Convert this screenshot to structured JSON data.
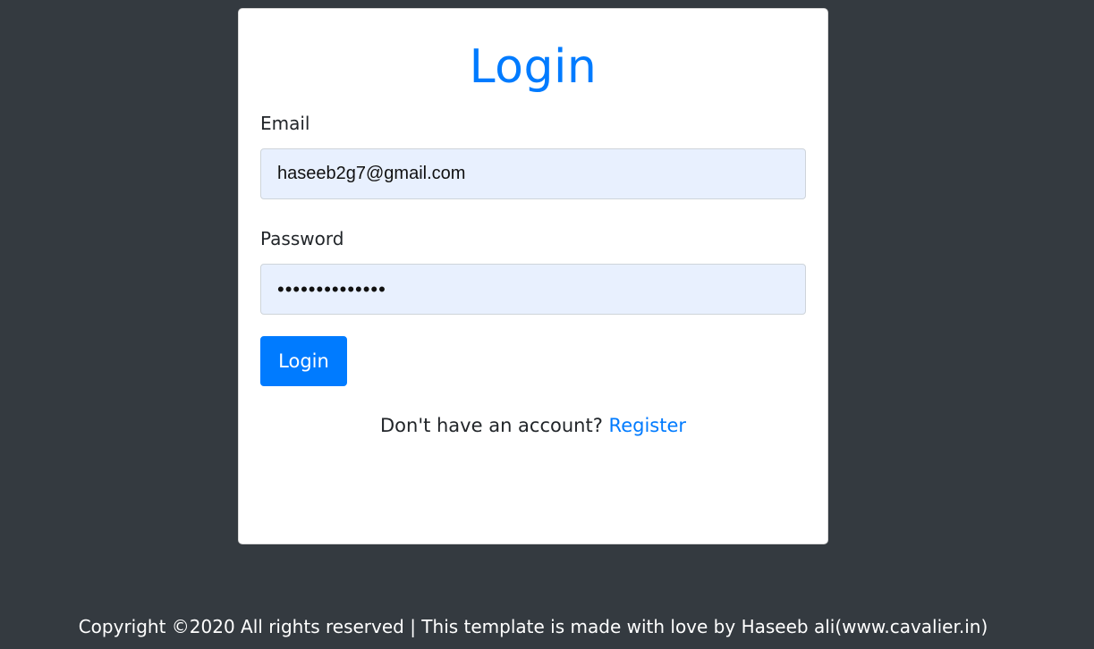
{
  "login_card": {
    "title": "Login",
    "email": {
      "label": "Email",
      "value": "haseeb2g7@gmail.com"
    },
    "password": {
      "label": "Password",
      "value": "••••••••••••••"
    },
    "submit_label": "Login",
    "register_prompt": "Don't have an account?",
    "register_link": "Register"
  },
  "footer": {
    "text": "Copyright ©2020 All rights reserved | This template is made with love by Haseeb ali(www.cavalier.in)"
  },
  "colors": {
    "page_background": "#343a40",
    "card_background": "#ffffff",
    "accent": "#007bff",
    "input_background": "#e8f0fe"
  }
}
